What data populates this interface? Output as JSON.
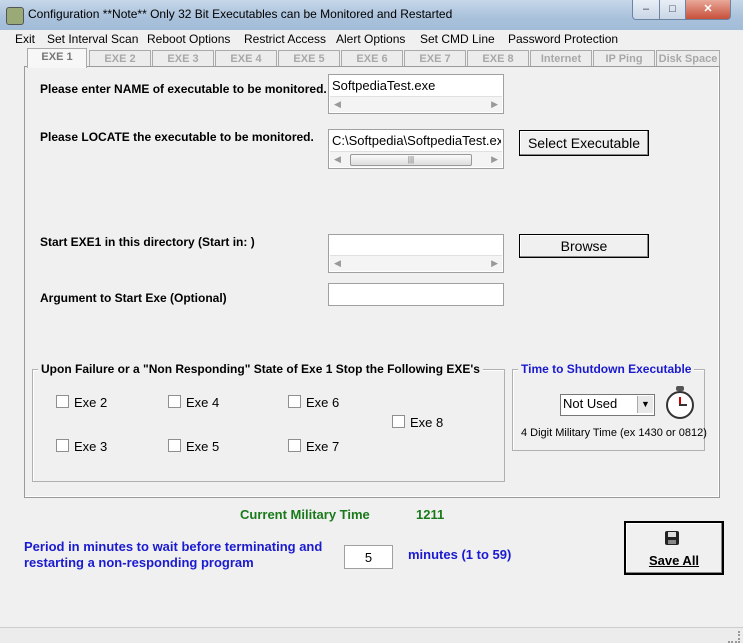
{
  "window": {
    "title": "Configuration  **Note** Only 32 Bit Executables can be Monitored and Restarted",
    "minimize": "–",
    "maximize": "□",
    "close": "✕"
  },
  "menu": [
    "Exit",
    "Set Interval Scan",
    "Reboot Options",
    "Restrict Access",
    "Alert Options",
    "Set CMD Line",
    "Password Protection"
  ],
  "tabs": [
    "EXE 1",
    "EXE 2",
    "EXE 3",
    "EXE 4",
    "EXE 5",
    "EXE 6",
    "EXE 7",
    "EXE 8",
    "Internet",
    "IP Ping",
    "Disk Space"
  ],
  "active_tab": "EXE 1",
  "form": {
    "name_label": "Please enter NAME of executable to be monitored.",
    "name_value": "SoftpediaTest.exe",
    "locate_label": "Please LOCATE the executable to be monitored.",
    "locate_value": "C:\\Softpedia\\SoftpediaTest.exe",
    "select_button": "Select Executable",
    "start_in_label": "Start EXE1 in this directory (Start in: )",
    "start_in_value": "",
    "browse_button": "Browse",
    "argument_label": "Argument to Start Exe (Optional)",
    "argument_value": ""
  },
  "failure_group": {
    "title": "Upon Failure or a \"Non Responding\" State of Exe 1 Stop the Following EXE's",
    "checkboxes": [
      "Exe 2",
      "Exe 4",
      "Exe 6",
      "Exe 8",
      "Exe 3",
      "Exe 5",
      "Exe 7"
    ]
  },
  "shutdown_group": {
    "title": "Time to Shutdown Executable",
    "selected": "Not Used",
    "hint": "4 Digit Military Time (ex 1430 or 0812)"
  },
  "current_time": {
    "label": "Current Military Time",
    "value": "1211"
  },
  "period": {
    "label_line1": "Period in minutes to wait before terminating and",
    "label_line2": "restarting a non-responding program",
    "value": "5",
    "units": "minutes (1 to 59)"
  },
  "save_button": "Save All",
  "colors": {
    "green_text": "#1a7a1a",
    "blue_text": "#1a1ad0",
    "dialog_bg": "#f0f0f0"
  }
}
